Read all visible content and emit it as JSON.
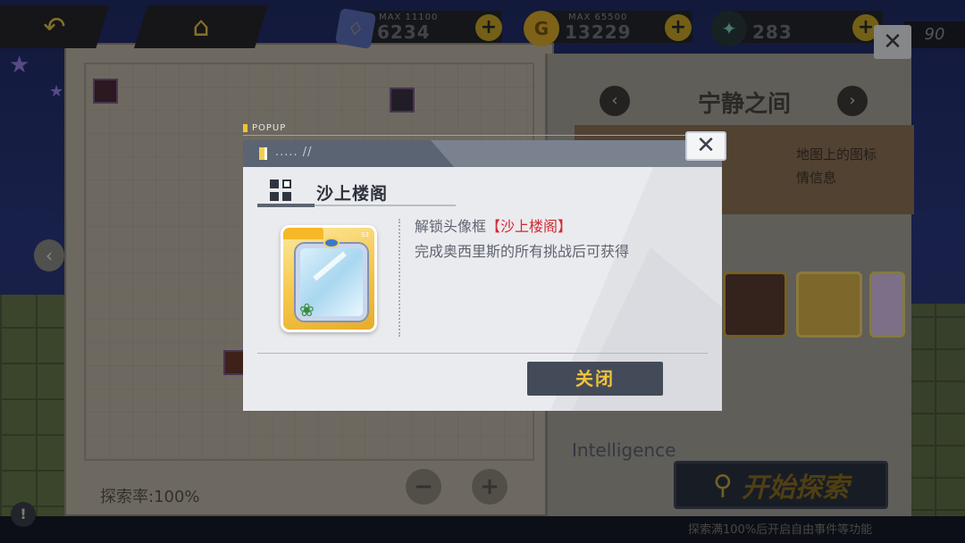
{
  "hud": {
    "resources": [
      {
        "name": "stamina",
        "icon": "stamina-card-icon",
        "max_label": "MAX 11100",
        "value": "6234"
      },
      {
        "name": "gold",
        "icon": "gold-coin-icon",
        "max_label": "MAX 65500",
        "value": "13229"
      },
      {
        "name": "gem",
        "icon": "gem-icon",
        "value": "283"
      }
    ],
    "plus_label": "+",
    "level": "90",
    "close_label": "✕"
  },
  "background": {
    "area_title": "宁静之间",
    "panel_hint_1": "地图上的图标",
    "panel_hint_2": "情信息",
    "explore_rate": "探索率:100%",
    "intelligence_label": "Intelligence",
    "start_explore_label": "开始探索",
    "bottom_hint": "探索满100%后开启自由事件等功能",
    "info_label": "!",
    "left_chevron": "‹",
    "prev_arrow": "‹",
    "next_arrow": "›",
    "zoom_out": "−",
    "zoom_in": "+"
  },
  "popup": {
    "tag": "POPUP",
    "header": "..... //",
    "close_label": "✕",
    "title": "沙上楼阁",
    "desc_prefix": "解锁头像框",
    "desc_highlight": "【沙上楼阁】",
    "desc_line2": "完成奥西里斯的所有挑战后可获得",
    "card_badge": "S3",
    "button_label": "关闭"
  },
  "colors": {
    "accent_yellow": "#f2c33a",
    "highlight_red": "#d22a35",
    "dark_button": "#444b58",
    "header_bar": "#5b6472"
  }
}
